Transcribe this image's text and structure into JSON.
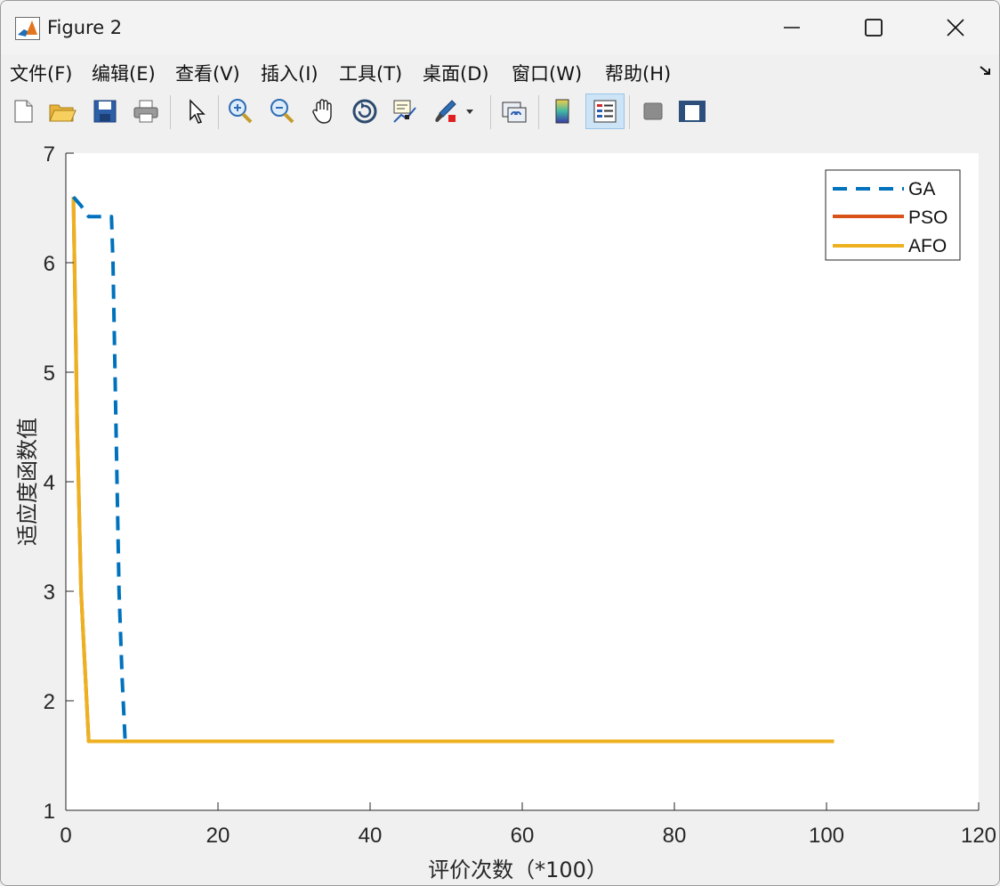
{
  "window": {
    "title": "Figure 2"
  },
  "menu": {
    "items": [
      {
        "label": "文件(F)"
      },
      {
        "label": "编辑(E)"
      },
      {
        "label": "查看(V)"
      },
      {
        "label": "插入(I)"
      },
      {
        "label": "工具(T)"
      },
      {
        "label": "桌面(D)"
      },
      {
        "label": "窗口(W)"
      },
      {
        "label": "帮助(H)"
      }
    ]
  },
  "toolbar": {
    "buttons": [
      {
        "icon": "new-figure-icon"
      },
      {
        "icon": "open-folder-icon"
      },
      {
        "icon": "save-icon"
      },
      {
        "icon": "print-icon"
      },
      {
        "icon": "pointer-icon"
      },
      {
        "icon": "zoom-in-icon"
      },
      {
        "icon": "zoom-out-icon"
      },
      {
        "icon": "pan-hand-icon"
      },
      {
        "icon": "rotate-3d-icon"
      },
      {
        "icon": "data-cursor-icon"
      },
      {
        "icon": "brush-icon"
      },
      {
        "icon": "link-plot-icon"
      },
      {
        "icon": "colorbar-icon"
      },
      {
        "icon": "legend-icon"
      },
      {
        "icon": "hide-plot-tools-icon"
      },
      {
        "icon": "show-plot-tools-icon"
      }
    ]
  },
  "chart_data": {
    "type": "line",
    "title": "",
    "xlabel": "评价次数（*100）",
    "ylabel": "适应度函数值",
    "xlim": [
      0,
      120
    ],
    "ylim": [
      1,
      7
    ],
    "xticks": [
      "0",
      "20",
      "40",
      "60",
      "80",
      "100",
      "120"
    ],
    "yticks": [
      "1",
      "2",
      "3",
      "4",
      "5",
      "6",
      "7"
    ],
    "grid": false,
    "legend_position": "top-right",
    "series": [
      {
        "name": "GA",
        "color": "#0072BD",
        "style": "dashed",
        "points": [
          [
            1,
            6.6
          ],
          [
            2,
            6.52
          ],
          [
            3,
            6.42
          ],
          [
            6,
            6.42
          ],
          [
            6.2,
            6.0
          ],
          [
            6.6,
            4.5
          ],
          [
            7,
            3.0
          ],
          [
            7.4,
            2.2
          ],
          [
            7.8,
            1.63
          ],
          [
            8,
            1.63
          ]
        ]
      },
      {
        "name": "PSO",
        "color": "#D95319",
        "style": "solid",
        "points": [
          [
            1,
            6.6
          ],
          [
            1.5,
            4.5
          ],
          [
            2,
            3.0
          ],
          [
            3,
            1.63
          ],
          [
            101,
            1.63
          ]
        ]
      },
      {
        "name": "AFO",
        "color": "#EDB120",
        "style": "solid",
        "points": [
          [
            1,
            6.6
          ],
          [
            1.5,
            4.5
          ],
          [
            2,
            3.0
          ],
          [
            3,
            1.63
          ],
          [
            101,
            1.63
          ]
        ]
      }
    ]
  }
}
